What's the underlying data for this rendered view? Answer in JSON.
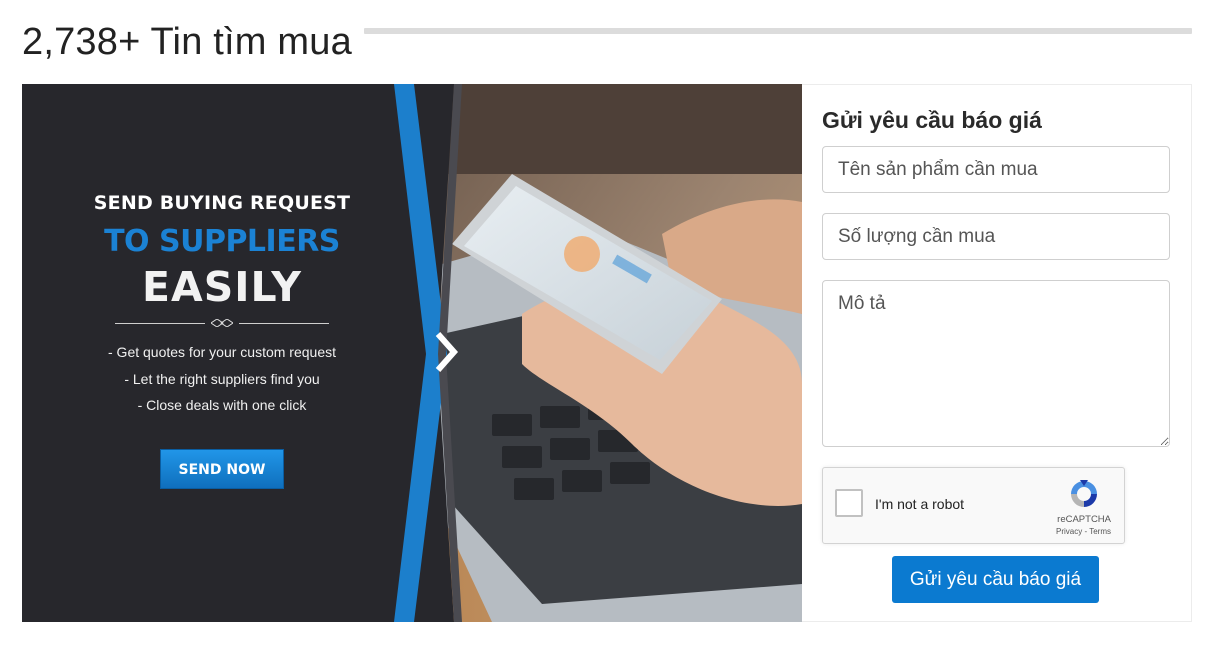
{
  "header": {
    "title": "2,738+ Tin tìm mua"
  },
  "banner": {
    "headline_1": "SEND BUYING REQUEST",
    "headline_2": "TO SUPPLIERS",
    "headline_3": "EASILY",
    "bullets": [
      "- Get quotes for your custom request",
      "- Let the right suppliers find you",
      "- Close deals with one click"
    ],
    "cta_label": "SEND NOW",
    "image_description_icon": "laptop-phone-photo",
    "accent_color": "#1b82d4"
  },
  "form": {
    "title": "Gửi yêu cầu báo giá",
    "product_placeholder": "Tên sản phẩm cần mua",
    "quantity_placeholder": "Số lượng cần mua",
    "description_placeholder": "Mô tả",
    "recaptcha": {
      "label": "I'm not a robot",
      "brand": "reCAPTCHA",
      "links": "Privacy - Terms"
    },
    "submit_label": "Gửi yêu cầu báo giá",
    "submit_color": "#0b7ad0"
  }
}
